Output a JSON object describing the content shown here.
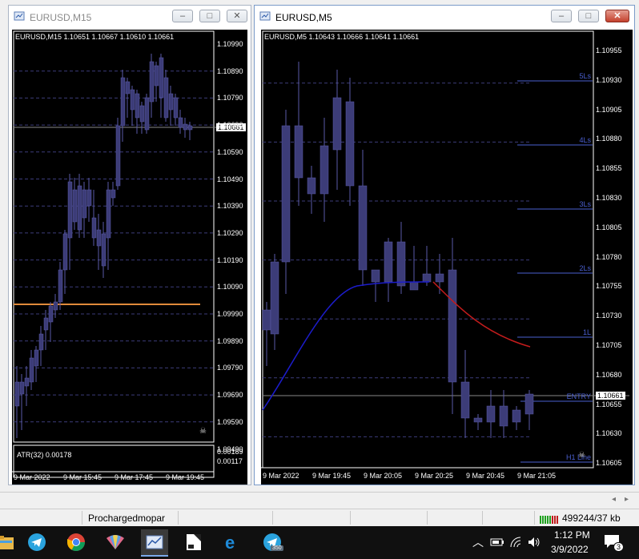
{
  "left_window": {
    "title": "EURUSD,M15",
    "header": "EURUSD,M15  1.10651 1.10667 1.10610 1.10661",
    "current_price": "1.10661",
    "price_ticks": [
      "1.10990",
      "1.10890",
      "1.10790",
      "1.10690",
      "1.10590",
      "1.10490",
      "1.10390",
      "1.10290",
      "1.10190",
      "1.10090",
      "1.09990",
      "1.09890",
      "1.09790",
      "1.09690",
      "1.09590",
      "1.09490"
    ],
    "date_ticks": [
      "9 Mar 2022",
      "9 Mar 15:45",
      "9 Mar 17:45",
      "9 Mar 19:45"
    ],
    "indicator_label": "ATR(32) 0.00178",
    "indicator_ticks": [
      "0.00189",
      "0.00117"
    ]
  },
  "right_window": {
    "title": "EURUSD,M5",
    "header": "EURUSD,M5  1.10643 1.10666 1.10641 1.10661",
    "current_price": "1.10661",
    "price_ticks": [
      "1.10955",
      "1.10930",
      "1.10905",
      "1.10880",
      "1.10855",
      "1.10830",
      "1.10805",
      "1.10780",
      "1.10755",
      "1.10730",
      "1.10705",
      "1.10680",
      "1.10655",
      "1.10630",
      "1.10605"
    ],
    "date_ticks": [
      "9 Mar 2022",
      "9 Mar 19:45",
      "9 Mar 20:05",
      "9 Mar 20:25",
      "9 Mar 20:45",
      "9 Mar 21:05"
    ],
    "levels": [
      "5Ls",
      "4Ls",
      "3Ls",
      "2Ls",
      "1L",
      "ENTRY",
      "H1 Line"
    ]
  },
  "controls": {
    "minimize": "–",
    "maximize": "□",
    "close": "✕"
  },
  "statusbar": {
    "profile": "Prochargedmopar",
    "connection": "499244/37 kb"
  },
  "taskbar": {
    "apps": [
      "explorer-icon",
      "telegram-icon",
      "chrome-icon",
      "fan-app-icon",
      "metatrader-icon",
      "notepad-icon",
      "edge-icon",
      "telegram-icon"
    ],
    "telegram_badge": "350",
    "time": "1:12 PM",
    "date": "3/9/2022",
    "notification_count": "3"
  },
  "colors": {
    "chart_bg": "#000000",
    "candle": "#3c3c78",
    "grid": "#3c3c7a",
    "blue_ma": "#1c1ccc",
    "red_ma": "#c41c1c",
    "level_line": "#4a5fd0",
    "orange_line": "#e08a3a"
  }
}
